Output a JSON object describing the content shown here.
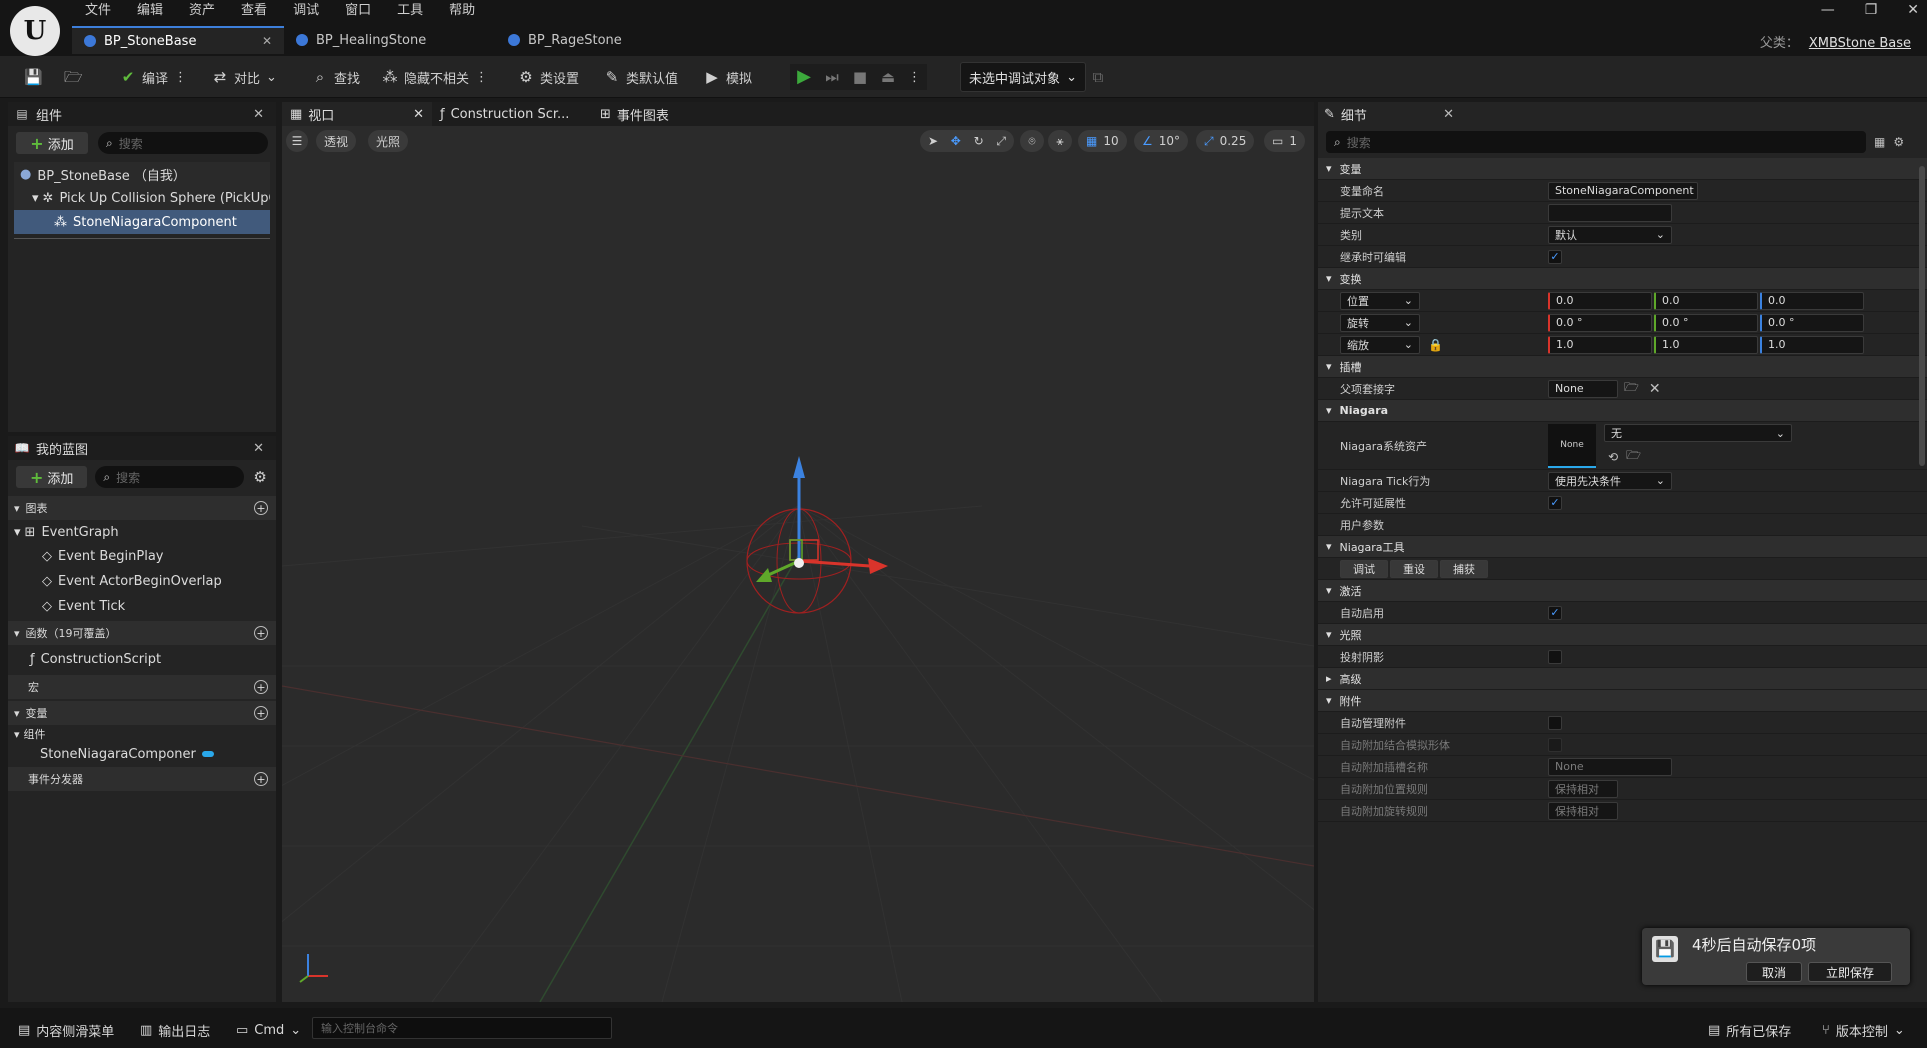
{
  "menu": [
    "文件",
    "编辑",
    "资产",
    "查看",
    "调试",
    "窗口",
    "工具",
    "帮助"
  ],
  "tabs": [
    {
      "label": "BP_StoneBase"
    },
    {
      "label": "BP_HealingStone"
    },
    {
      "label": "BP_RageStone"
    }
  ],
  "parent_class": {
    "label": "父类：",
    "value": "XMBStone Base"
  },
  "toolbar": {
    "compile": "编译",
    "diff": "对比",
    "find": "查找",
    "hide_unrelated": "隐藏不相关",
    "class_settings": "类设置",
    "class_defaults": "类默认值",
    "simulate": "模拟",
    "debug_select": "未选中调试对象"
  },
  "components_panel": {
    "title": "组件",
    "add_label": "添加",
    "search_placeholder": "搜索",
    "items": [
      "BP_StoneBase （自我）",
      "Pick Up Collision Sphere (PickUpColl",
      "StoneNiagaraComponent"
    ]
  },
  "my_blueprint": {
    "title": "我的蓝图",
    "add_label": "添加",
    "search_placeholder": "搜索",
    "graphs_section": "图表",
    "event_graph": "EventGraph",
    "events": [
      "Event BeginPlay",
      "Event ActorBeginOverlap",
      "Event Tick"
    ],
    "functions_section": "函数（19可覆盖）",
    "construction_script": "ConstructionScript",
    "macros_section": "宏",
    "variables_section": "变量",
    "components_group": "组件",
    "component_var": "StoneNiagaraComponer",
    "dispatchers_section": "事件分发器"
  },
  "viewport": {
    "tabs": [
      "视口",
      "Construction Scr...",
      "事件图表"
    ],
    "perspective": "透视",
    "lit": "光照",
    "grid_snap": "10",
    "rot_snap": "10°",
    "scale_snap": "0.25",
    "camera_speed": "1"
  },
  "details": {
    "title": "细节",
    "search_placeholder": "搜索",
    "sections": {
      "variable": "变量",
      "transform": "变换",
      "sockets": "插槽",
      "niagara": "Niagara",
      "niagara_tools": "Niagara工具",
      "activation": "激活",
      "lighting": "光照",
      "advanced": "高级",
      "attachment": "附件"
    },
    "variable_name_label": "变量命名",
    "variable_name_value": "StoneNiagaraComponent",
    "tooltip_label": "提示文本",
    "category_label": "类别",
    "category_value": "默认",
    "editable_label": "继承时可编辑",
    "location_label": "位置",
    "location": [
      "0.0",
      "0.0",
      "0.0"
    ],
    "rotation_label": "旋转",
    "rotation": [
      "0.0 °",
      "0.0 °",
      "0.0 °"
    ],
    "scale_label": "缩放",
    "scale": [
      "1.0",
      "1.0",
      "1.0"
    ],
    "parent_socket_label": "父项套接字",
    "parent_socket_value": "None",
    "niagara_asset_label": "Niagara系统资产",
    "niagara_asset_thumb": "None",
    "niagara_asset_value": "无",
    "tick_label": "Niagara Tick行为",
    "tick_value": "使用先决条件",
    "scalability_label": "允许可延展性",
    "user_params_label": "用户参数",
    "tool_buttons": [
      "调试",
      "重设",
      "捕获"
    ],
    "auto_activate_label": "自动启用",
    "cast_shadow_label": "投射阴影",
    "auto_manage_label": "自动管理附件",
    "auto_weld_label": "自动附加结合模拟形体",
    "auto_socket_label": "自动附加插槽名称",
    "auto_socket_value": "None",
    "auto_loc_rule_label": "自动附加位置规则",
    "auto_loc_rule_value": "保持相对",
    "auto_rot_rule_label": "自动附加旋转规则",
    "auto_rot_rule_value": "保持相对"
  },
  "bottombar": {
    "content_drawer": "内容侧滑菜单",
    "output_log": "输出日志",
    "cmd": "Cmd",
    "console_placeholder": "输入控制台命令",
    "all_saved": "所有已保存",
    "source_control": "版本控制"
  },
  "toast": {
    "message": "4秒后自动保存0项",
    "cancel": "取消",
    "save_now": "立即保存"
  },
  "colors": {
    "accent": "#3d7fdb",
    "x_axis": "#d9342b",
    "y_axis": "#5fa82a",
    "z_axis": "#3b82e0"
  }
}
